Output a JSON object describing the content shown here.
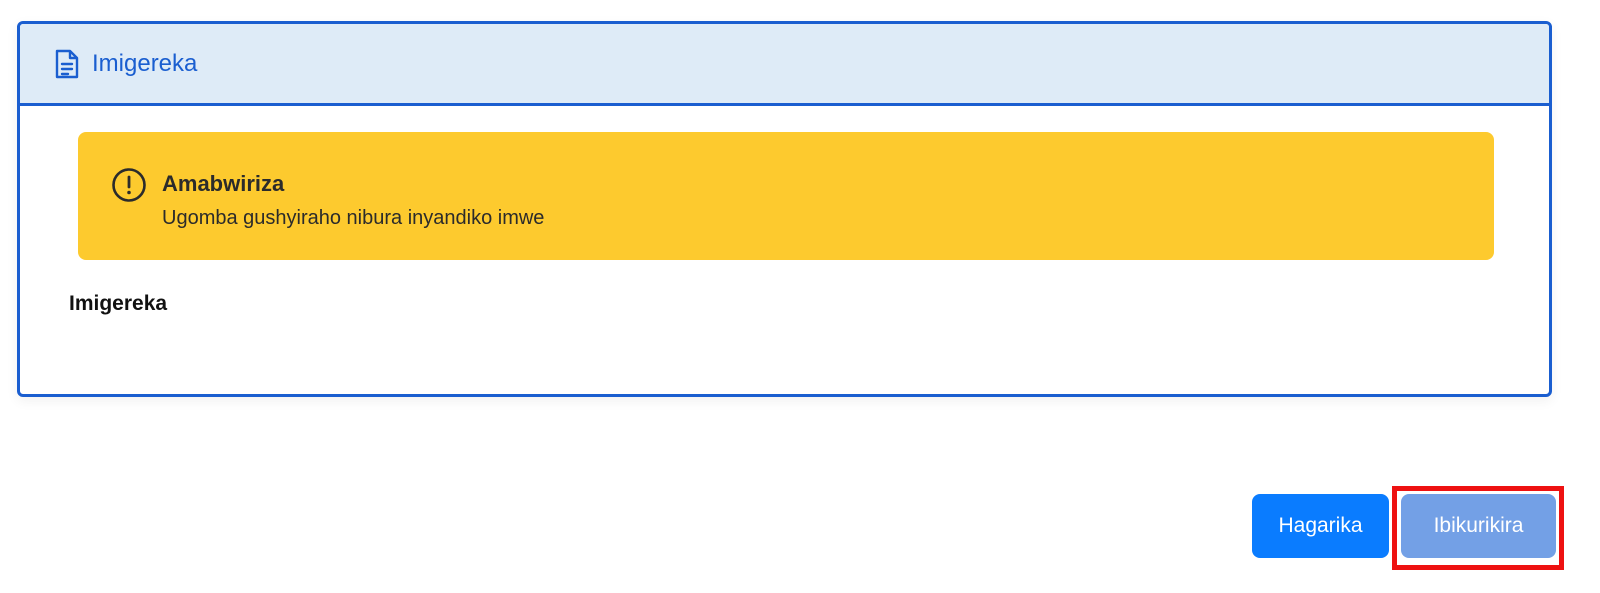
{
  "card": {
    "title": "Imigereka",
    "title_icon": "document-icon"
  },
  "alert": {
    "icon": "exclamation-circle-icon",
    "title": "Amabwiriza",
    "message": "Ugomba gushyiraho nibura inyandiko imwe"
  },
  "section": {
    "label": "Imigereka"
  },
  "buttons": {
    "cancel_label": "Hagarika",
    "continue_label": "Ibikurikira"
  },
  "colors": {
    "accent": "#1a5ed0",
    "header_bg": "#deebf7",
    "alert_bg": "#fdca2e",
    "cancel_bg": "#0a7cff",
    "continue_bg": "#73a0e6",
    "highlight": "#ee1111"
  }
}
